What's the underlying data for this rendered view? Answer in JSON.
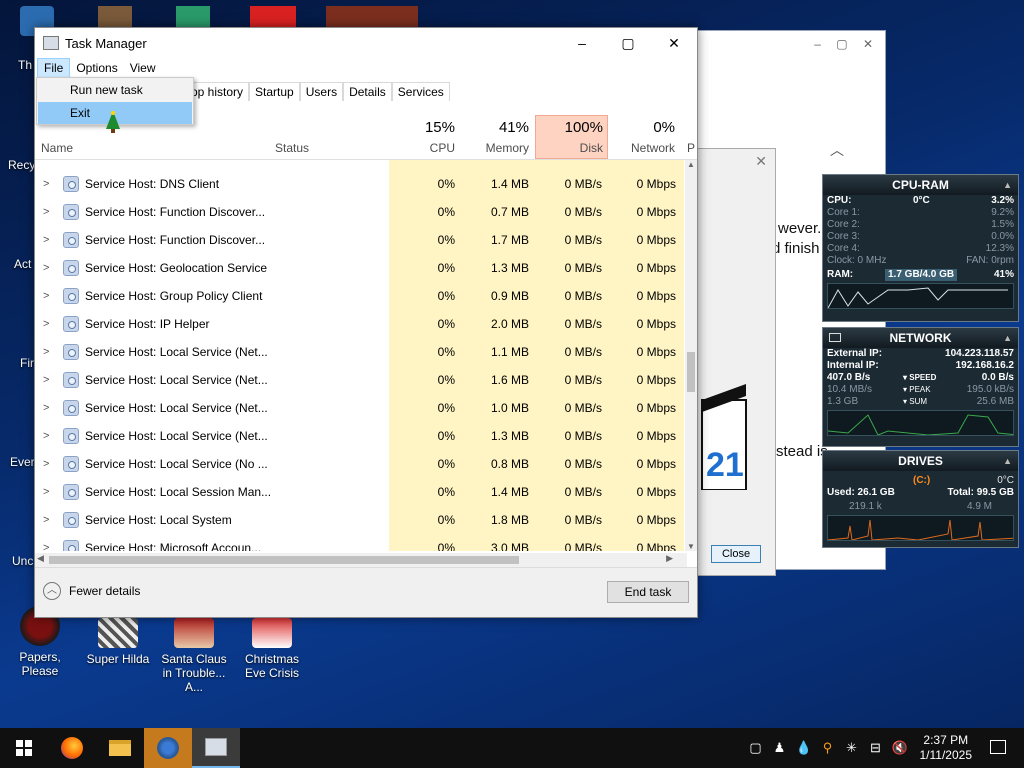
{
  "desktop": {
    "icons": [
      {
        "label": "Papers, Please"
      },
      {
        "label": "Super Hilda"
      },
      {
        "label": "Santa Claus in Trouble... A..."
      },
      {
        "label": "Christmas Eve Crisis"
      }
    ],
    "partial_labels": [
      "Th",
      "Recy",
      "Act",
      "Fir",
      "Ever",
      "Unc"
    ]
  },
  "background_window": {
    "text_lines": [
      "wever.",
      "d finish",
      "stead is"
    ],
    "close_label": "Close",
    "clapper_number": "21"
  },
  "task_manager": {
    "title": "Task Manager",
    "menu": {
      "file": "File",
      "options": "Options",
      "view": "View"
    },
    "file_menu_items": [
      "Run new task",
      "Exit"
    ],
    "tabs": [
      "pp history",
      "Startup",
      "Users",
      "Details",
      "Services"
    ],
    "columns": {
      "name": "Name",
      "status": "Status",
      "cpu": {
        "pct": "15%",
        "label": "CPU"
      },
      "memory": {
        "pct": "41%",
        "label": "Memory"
      },
      "disk": {
        "pct": "100%",
        "label": "Disk"
      },
      "network": {
        "pct": "0%",
        "label": "Network"
      },
      "cut": "P"
    },
    "rows": [
      {
        "name": "Service Host: DNS Client",
        "cpu": "0%",
        "memory": "1.4 MB",
        "disk": "0 MB/s",
        "network": "0 Mbps"
      },
      {
        "name": "Service Host: Function Discover...",
        "cpu": "0%",
        "memory": "0.7 MB",
        "disk": "0 MB/s",
        "network": "0 Mbps"
      },
      {
        "name": "Service Host: Function Discover...",
        "cpu": "0%",
        "memory": "1.7 MB",
        "disk": "0 MB/s",
        "network": "0 Mbps"
      },
      {
        "name": "Service Host: Geolocation Service",
        "cpu": "0%",
        "memory": "1.3 MB",
        "disk": "0 MB/s",
        "network": "0 Mbps"
      },
      {
        "name": "Service Host: Group Policy Client",
        "cpu": "0%",
        "memory": "0.9 MB",
        "disk": "0 MB/s",
        "network": "0 Mbps"
      },
      {
        "name": "Service Host: IP Helper",
        "cpu": "0%",
        "memory": "2.0 MB",
        "disk": "0 MB/s",
        "network": "0 Mbps"
      },
      {
        "name": "Service Host: Local Service (Net...",
        "cpu": "0%",
        "memory": "1.1 MB",
        "disk": "0 MB/s",
        "network": "0 Mbps"
      },
      {
        "name": "Service Host: Local Service (Net...",
        "cpu": "0%",
        "memory": "1.6 MB",
        "disk": "0 MB/s",
        "network": "0 Mbps"
      },
      {
        "name": "Service Host: Local Service (Net...",
        "cpu": "0%",
        "memory": "1.0 MB",
        "disk": "0 MB/s",
        "network": "0 Mbps"
      },
      {
        "name": "Service Host: Local Service (Net...",
        "cpu": "0%",
        "memory": "1.3 MB",
        "disk": "0 MB/s",
        "network": "0 Mbps"
      },
      {
        "name": "Service Host: Local Service (No ...",
        "cpu": "0%",
        "memory": "0.8 MB",
        "disk": "0 MB/s",
        "network": "0 Mbps"
      },
      {
        "name": "Service Host: Local Session Man...",
        "cpu": "0%",
        "memory": "1.4 MB",
        "disk": "0 MB/s",
        "network": "0 Mbps"
      },
      {
        "name": "Service Host: Local System",
        "cpu": "0%",
        "memory": "1.8 MB",
        "disk": "0 MB/s",
        "network": "0 Mbps"
      },
      {
        "name": "Service Host: Microsoft Accoun...",
        "cpu": "0%",
        "memory": "3.0 MB",
        "disk": "0 MB/s",
        "network": "0 Mbps"
      }
    ],
    "fewer_details": "Fewer details",
    "end_task": "End task"
  },
  "gadgets": {
    "cpu_ram": {
      "title": "CPU-RAM",
      "cpu_label": "CPU:",
      "cpu_temp": "0°C",
      "cpu_pct": "3.2%",
      "cores": [
        {
          "label": "Core 1:",
          "value": "9.2%"
        },
        {
          "label": "Core 2:",
          "value": "1.5%"
        },
        {
          "label": "Core 3:",
          "value": "0.0%"
        },
        {
          "label": "Core 4:",
          "value": "12.3%"
        }
      ],
      "clock": "Clock: 0 MHz",
      "fan": "FAN: 0rpm",
      "ram_label": "RAM:",
      "ram_used": "1.7 GB/4.0 GB",
      "ram_pct": "41%"
    },
    "network": {
      "title": "NETWORK",
      "external_label": "External IP:",
      "external_ip": "104.223.118.57",
      "internal_label": "Internal IP:",
      "internal_ip": "192.168.16.2",
      "rate1": "407.0 B/s",
      "speed_label": "SPEED",
      "speed": "0.0 B/s",
      "rate2": "10.4 MB/s",
      "peak_label": "PEAK",
      "peak": "195.0 kB/s",
      "total": "1.3 GB",
      "sum_label": "SUM",
      "sum": "25.6 MB"
    },
    "drives": {
      "title": "DRIVES",
      "drive_label": "(C:)",
      "temp": "0°C",
      "used": "Used: 26.1 GB",
      "total": "Total: 99.5 GB",
      "read": "219.1 k",
      "write": "4.9 M"
    }
  },
  "taskbar": {
    "time": "2:37 PM",
    "date": "1/11/2025"
  },
  "colors": {
    "disk_hot": "#ffd3c2",
    "col_highlight": "#fff4c4",
    "menu_select": "#91c9f7"
  }
}
